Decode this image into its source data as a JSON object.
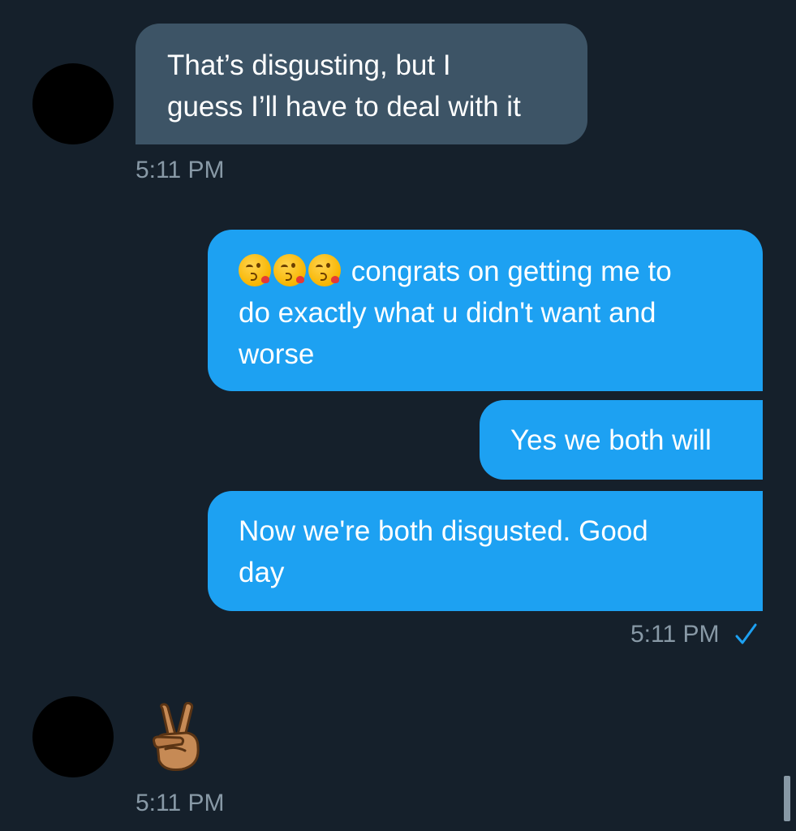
{
  "conversation": {
    "messages": [
      {
        "direction": "received",
        "text": "That’s disgusting, but I guess I’ll have to deal with it",
        "line1": "That’s disgusting, but I",
        "line2": "guess I’ll have to deal with it",
        "timestamp": "5:11 PM"
      },
      {
        "direction": "sent",
        "emoji": "kissing-face-emoji",
        "emoji_count": 3,
        "text": "congrats on getting me to do exactly what u didn't want and worse",
        "line1": "congrats on getting me to",
        "line2": "do exactly what u didn't want and",
        "line3": "worse"
      },
      {
        "direction": "sent",
        "text": "Yes we both will"
      },
      {
        "direction": "sent",
        "text": "Now we're both disgusted. Good day",
        "line1": "Now we're both disgusted. Good",
        "line2": "day",
        "timestamp": "5:11 PM",
        "status_icon": "checkmark-icon"
      },
      {
        "direction": "received",
        "emoji": "victory-hand-emoji",
        "timestamp": "5:11 PM"
      }
    ]
  },
  "colors": {
    "background": "#15202b",
    "received_bubble": "#3d5466",
    "sent_bubble": "#1da1f2",
    "timestamp": "#8899a6",
    "read_check": "#1da1f2",
    "avatar": "#000000"
  }
}
